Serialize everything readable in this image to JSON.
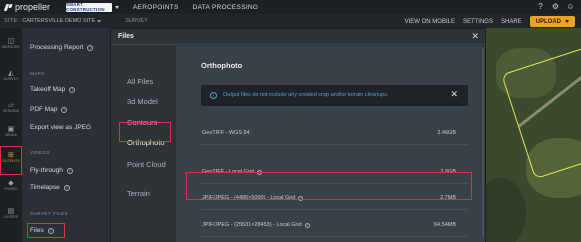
{
  "topbar": {
    "logo_text": "propeller",
    "brand_label": "SMART CONSTRUCTION",
    "nav": [
      "AEROPOINTS",
      "DATA PROCESSING"
    ]
  },
  "subbar": {
    "site_label": "SITE:",
    "site_name": "CARTERSVILLE DEMO SITE",
    "survey_text": "SURVEY",
    "view_mobile": "VIEW ON MOBILE",
    "settings": "SETTINGS",
    "share": "SHARE",
    "upload": "UPLOAD"
  },
  "rail": [
    {
      "icon": "measure-icon",
      "label": "MEASURE"
    },
    {
      "icon": "survey-icon",
      "label": "SURVEY"
    },
    {
      "icon": "design-icon",
      "label": "DESIGNS"
    },
    {
      "icon": "media-icon",
      "label": "MEDIA"
    },
    {
      "icon": "outputs-icon",
      "label": "OUTPUTS"
    },
    {
      "icon": "hydro-icon",
      "label": "HYDRO"
    },
    {
      "icon": "layer-icon",
      "label": "LAYERS"
    }
  ],
  "panel": {
    "processing_report": "Processing Report",
    "maps_header": "MAPS",
    "takeoff_map": "Takeoff Map",
    "pdf_map": "PDF Map",
    "export_jpeg": "Export view as JPEG",
    "videos_header": "VIDEOS",
    "fly_through": "Fly-through",
    "timelapse": "Timelapse",
    "survey_files_header": "SURVEY FILES",
    "files": "Files"
  },
  "modal": {
    "title": "Files",
    "close": "✕",
    "side_items": [
      "All Files",
      "3d Model",
      "Contours",
      "Orthophoto",
      "Point Cloud",
      "Terrain"
    ],
    "content_title": "Orthophoto",
    "info_text": "Output files do not include any created crop and/or terrain cleanups.",
    "files": [
      {
        "name": "GeoTIFF - WGS 84",
        "size": "2.46GB"
      },
      {
        "name": "GeoTIFF - Local Grid",
        "size": "2.8GB"
      },
      {
        "name": "JPIF/JPEG - (4486×5000) - Local Grid",
        "size": "2.7MB"
      },
      {
        "name": "JPIF/JPEG - (25531×28453) - Local Grid",
        "size": "64.54MB"
      }
    ]
  },
  "colors": {
    "accent": "#f0a31f",
    "highlight": "#e0303a",
    "info": "#4aa3df"
  }
}
